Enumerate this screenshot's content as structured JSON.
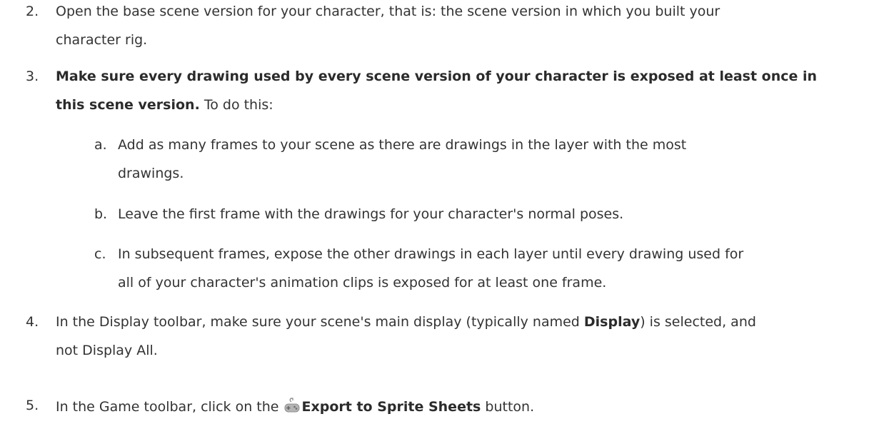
{
  "steps": [
    {
      "number": "2.",
      "lines": [
        "Open the base scene version for your character, that is: the scene version in which you built your",
        "character rig."
      ]
    },
    {
      "number": "3.",
      "bold_1": "Make sure every drawing used by every scene version of your character is exposed at least once in",
      "bold_2": "this scene version.",
      "rest_2": " To do this:",
      "substeps": [
        {
          "letter": "a.",
          "lines": [
            "Add as many frames to your scene as there are drawings in the layer with the most",
            "drawings."
          ]
        },
        {
          "letter": "b.",
          "lines": [
            "Leave the first frame with the drawings for your character's normal poses."
          ]
        },
        {
          "letter": "c.",
          "lines": [
            "In subsequent frames, expose the other drawings in each layer until every drawing used for",
            "all of your character's animation clips is exposed for at least one frame."
          ]
        }
      ]
    },
    {
      "number": "4.",
      "pre_1": "In the Display toolbar, make sure your scene's main display (typically named ",
      "bold_1": "Display",
      "post_1": ") is selected, and",
      "line_2": "not Display All."
    },
    {
      "number": "5.",
      "pre": "In the Game toolbar, click on the ",
      "icon": "export-to-sprite-sheets-icon",
      "bold": "Export to Sprite Sheets",
      "post": " button."
    }
  ]
}
